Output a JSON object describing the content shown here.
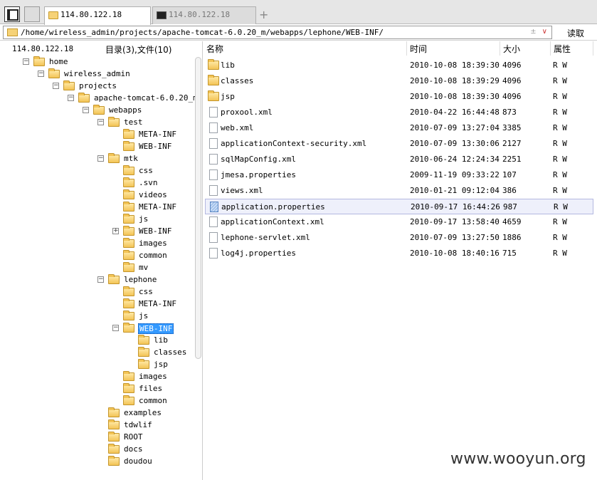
{
  "tabs": [
    {
      "label": "114.80.122.18",
      "icon": "folder-icon",
      "active": true
    },
    {
      "label": "114.80.122.18",
      "icon": "terminal-icon",
      "active": false
    }
  ],
  "tab_add": "+",
  "path": {
    "value": "/home/wireless_admin/projects/apache-tomcat-6.0.20_m/webapps/lephone/WEB-INF/",
    "ctrl_a": "±",
    "ctrl_b": "∨",
    "read_label": "读取"
  },
  "left": {
    "host": "114.80.122.18",
    "count": "目录(3),文件(10)",
    "tree": [
      {
        "label": "home",
        "toggle": "−"
      },
      {
        "label": "wireless_admin",
        "toggle": "−"
      },
      {
        "label": "projects",
        "toggle": "−"
      },
      {
        "label": "apache-tomcat-6.0.20_m",
        "toggle": "−"
      },
      {
        "label": "webapps",
        "toggle": "−"
      },
      {
        "label": "test",
        "toggle": "−"
      },
      {
        "label": "META-INF",
        "toggle": ""
      },
      {
        "label": "WEB-INF",
        "toggle": ""
      },
      {
        "label": "mtk",
        "toggle": "−"
      },
      {
        "label": "css",
        "toggle": ""
      },
      {
        "label": ".svn",
        "toggle": ""
      },
      {
        "label": "videos",
        "toggle": ""
      },
      {
        "label": "META-INF",
        "toggle": ""
      },
      {
        "label": "js",
        "toggle": ""
      },
      {
        "label": "WEB-INF",
        "toggle": "+"
      },
      {
        "label": "images",
        "toggle": ""
      },
      {
        "label": "common",
        "toggle": ""
      },
      {
        "label": "mv",
        "toggle": ""
      },
      {
        "label": "lephone",
        "toggle": "−"
      },
      {
        "label": "css",
        "toggle": ""
      },
      {
        "label": "META-INF",
        "toggle": ""
      },
      {
        "label": "js",
        "toggle": ""
      },
      {
        "label": "WEB-INF",
        "toggle": "−",
        "selected": true
      },
      {
        "label": "lib",
        "toggle": ""
      },
      {
        "label": "classes",
        "toggle": ""
      },
      {
        "label": "jsp",
        "toggle": ""
      },
      {
        "label": "images",
        "toggle": ""
      },
      {
        "label": "files",
        "toggle": ""
      },
      {
        "label": "common",
        "toggle": ""
      },
      {
        "label": "examples",
        "toggle": ""
      },
      {
        "label": "tdwlif",
        "toggle": ""
      },
      {
        "label": "ROOT",
        "toggle": ""
      },
      {
        "label": "docs",
        "toggle": ""
      },
      {
        "label": "doudou",
        "toggle": ""
      }
    ]
  },
  "columns": {
    "name": "名称",
    "time": "时间",
    "size": "大小",
    "attr": "属性"
  },
  "files": [
    {
      "name": "lib",
      "time": "2010-10-08 18:39:30",
      "size": "4096",
      "attr": "R W",
      "type": "folder"
    },
    {
      "name": "classes",
      "time": "2010-10-08 18:39:29",
      "size": "4096",
      "attr": "R W",
      "type": "folder"
    },
    {
      "name": "jsp",
      "time": "2010-10-08 18:39:30",
      "size": "4096",
      "attr": "R W",
      "type": "folder"
    },
    {
      "name": "proxool.xml",
      "time": "2010-04-22 16:44:48",
      "size": "873",
      "attr": "R W",
      "type": "file"
    },
    {
      "name": "web.xml",
      "time": "2010-07-09 13:27:04",
      "size": "3385",
      "attr": "R W",
      "type": "file"
    },
    {
      "name": "applicationContext-security.xml",
      "time": "2010-07-09 13:30:06",
      "size": "2127",
      "attr": "R W",
      "type": "file"
    },
    {
      "name": "sqlMapConfig.xml",
      "time": "2010-06-24 12:24:34",
      "size": "2251",
      "attr": "R W",
      "type": "file"
    },
    {
      "name": "jmesa.properties",
      "time": "2009-11-19 09:33:22",
      "size": "107",
      "attr": "R W",
      "type": "file"
    },
    {
      "name": "views.xml",
      "time": "2010-01-21 09:12:04",
      "size": "386",
      "attr": "R W",
      "type": "file"
    },
    {
      "name": "application.properties",
      "time": "2010-09-17 16:44:26",
      "size": "987",
      "attr": "R W",
      "type": "file",
      "selected": true
    },
    {
      "name": "applicationContext.xml",
      "time": "2010-09-17 13:58:40",
      "size": "4659",
      "attr": "R W",
      "type": "file"
    },
    {
      "name": "lephone-servlet.xml",
      "time": "2010-07-09 13:27:50",
      "size": "1886",
      "attr": "R W",
      "type": "file"
    },
    {
      "name": "log4j.properties",
      "time": "2010-10-08 18:40:16",
      "size": "715",
      "attr": "R W",
      "type": "file"
    }
  ],
  "watermark": "www.wooyun.org"
}
